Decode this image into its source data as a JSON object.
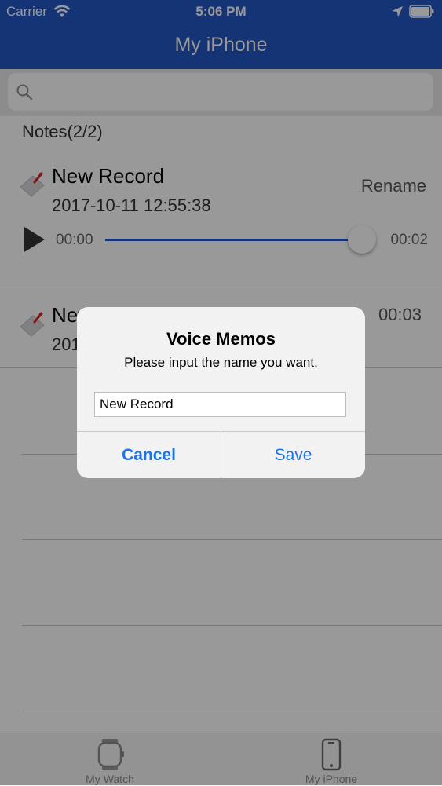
{
  "status_bar": {
    "carrier": "Carrier",
    "time": "5:06 PM"
  },
  "nav": {
    "title": "My iPhone"
  },
  "search": {
    "placeholder": ""
  },
  "list": {
    "section_title": "Notes(2/2)",
    "items": [
      {
        "name": "New Record",
        "date": "2017-10-11 12:55:38",
        "action": "Rename",
        "player": {
          "elapsed": "00:00",
          "total": "00:02",
          "progress": 0.97
        }
      },
      {
        "name": "New Record",
        "date": "2017-10-11",
        "duration": "00:03"
      }
    ]
  },
  "tabbar": {
    "tabs": [
      {
        "label": "My Watch",
        "icon": "watch-icon"
      },
      {
        "label": "My iPhone",
        "icon": "phone-icon"
      }
    ]
  },
  "dialog": {
    "title": "Voice Memos",
    "message": "Please input the name you want.",
    "input_value": "New Record",
    "cancel_label": "Cancel",
    "save_label": "Save"
  },
  "colors": {
    "nav_bar": "#2458c5",
    "accent": "#1a73e8",
    "overlay": "rgba(0,0,0,0.40)"
  }
}
